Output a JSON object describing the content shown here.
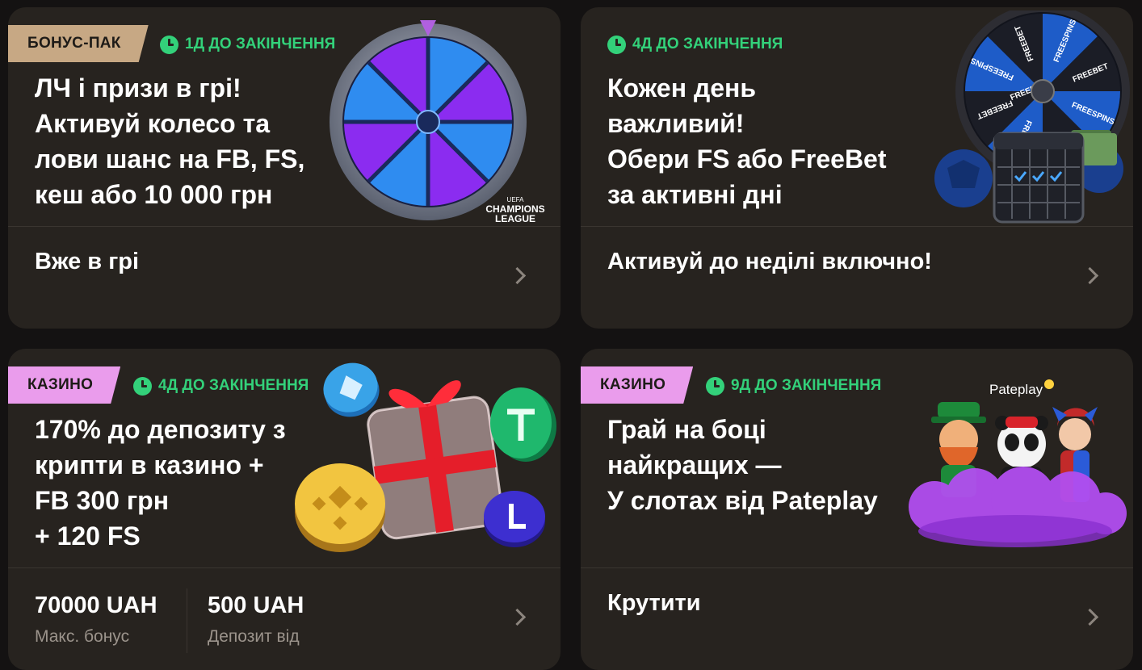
{
  "cards": [
    {
      "tag": "БОНУС-ПАК",
      "expiry": "1Д ДО ЗАКІНЧЕННЯ",
      "title_lines": [
        "ЛЧ і призи в грі!",
        "Активуй колесо та",
        "лови шанс на FB, FS,",
        "кеш або 10 000 грн"
      ],
      "subtitle": "Вже в грі",
      "art": {
        "logo_line1": "UEFA",
        "logo_line2": "CHAMPIONS",
        "logo_line3": "LEAGUE"
      }
    },
    {
      "expiry": "4Д ДО ЗАКІНЧЕННЯ",
      "title_lines": [
        "Кожен день",
        "важливий!",
        "Обери FS або FreeBet",
        "за активні дні"
      ],
      "subtitle": "Активуй до неділі включно!",
      "art": {
        "wheel_labels": [
          "FREEBET",
          "FREESPINS",
          "FREEBET",
          "FREESPINS",
          "FREEBET",
          "FREESPINS",
          "FREEBET",
          "FREESPINS"
        ]
      }
    },
    {
      "tag": "КАЗИНО",
      "expiry": "4Д ДО ЗАКІНЧЕННЯ",
      "title_lines": [
        "170% до депозиту з",
        "крипти в казино +",
        "FB 300 грн",
        "+ 120 FS"
      ],
      "stats": [
        {
          "value": "70000 UAH",
          "label": "Макс. бонус"
        },
        {
          "value": "500 UAH",
          "label": "Депозит від"
        }
      ]
    },
    {
      "tag": "КАЗИНО",
      "expiry": "9Д ДО ЗАКІНЧЕННЯ",
      "title_lines": [
        "Грай на боці",
        "найкращих —",
        "У слотах від Pateplay"
      ],
      "subtitle": "Крутити",
      "art": {
        "brand": "Pateplay"
      }
    }
  ],
  "colors": {
    "page_bg": "#141212",
    "card_bg": "#27231f",
    "timer_green": "#33d17a",
    "bonus_tag": "#c7a884",
    "casino_tag": "#ea9cec",
    "muted_text": "#9b938b"
  }
}
